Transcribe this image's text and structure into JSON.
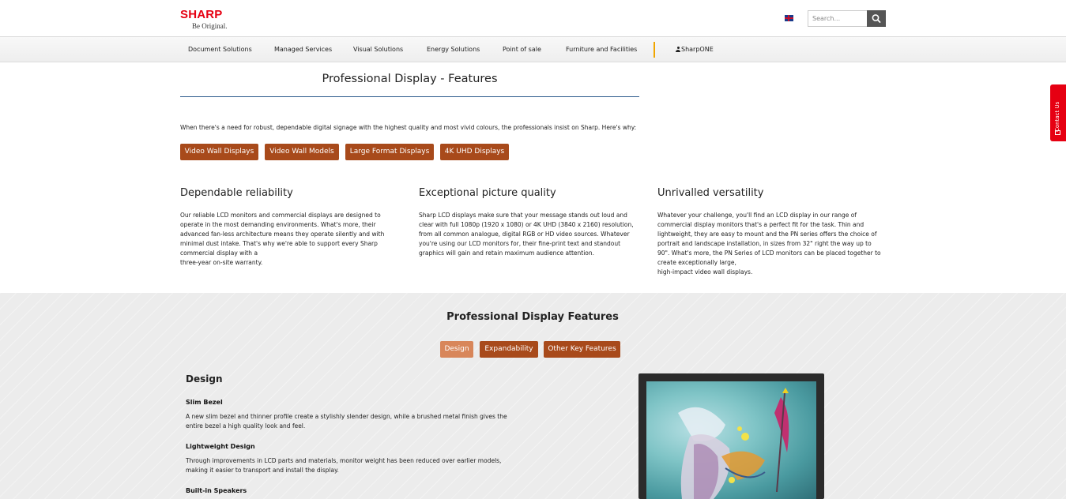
{
  "header": {
    "brand": "SHARP",
    "tagline": "Be Original.",
    "language_icon": "uk-flag-icon",
    "search": {
      "placeholder": "Search...",
      "icon": "search-icon"
    }
  },
  "nav": {
    "items": [
      {
        "label": "Document Solutions"
      },
      {
        "label": "Managed Services"
      },
      {
        "label": "Visual Solutions"
      },
      {
        "label": "Energy Solutions"
      },
      {
        "label": "Point of sale"
      },
      {
        "label": "Furniture and Facilities"
      }
    ],
    "account": {
      "label": "SharpONE",
      "icon": "user-icon"
    }
  },
  "main": {
    "title": "Professional Display - Features",
    "intro": "When there's a need for robust, dependable digital signage with the highest quality and most vivid colours, the professionals insist on Sharp. Here's why:",
    "buttons": [
      {
        "label": "Video Wall Displays"
      },
      {
        "label": "Video Wall Models"
      },
      {
        "label": "Large Format Displays"
      },
      {
        "label": "4K UHD Displays"
      }
    ],
    "columns": [
      {
        "heading": "Dependable reliability",
        "lines": [
          "Our reliable LCD monitors and commercial displays are designed to",
          "operate in the most demanding environments. What's more, their",
          "advanced fan-less architecture means they operate silently and with",
          "minimal dust intake. That's why we're able to support every Sharp",
          "commercial display with a",
          "three-year on-site warranty."
        ]
      },
      {
        "heading": "Exceptional picture quality",
        "lines": [
          "Sharp LCD displays make sure that your message stands out loud and",
          "clear with full 1080p (1920 x 1080) or 4K UHD (3840 x 2160) resolution,",
          "from all common analogue, digital RGB or HD video sources. Whatever",
          "you're using our LCD monitors for, their fine-print text and standout",
          "graphics will gain and retain maximum audience attention."
        ]
      },
      {
        "heading": "Unrivalled versatility",
        "lines": [
          "Whatever your challenge, you'll find an LCD display in our range of",
          "commercial display monitors that's a perfect fit for the task. Thin and",
          "lightweight, they are easy to mount and the PN series offers the choice of",
          "portrait and landscape installation, in sizes from 32\" right the way up to",
          "90\". What's more, the PN Series of LCD monitors can be placed together to",
          "create exceptionally large,",
          "high-impact video wall displays."
        ]
      }
    ]
  },
  "features": {
    "title": "Professional Display Features",
    "tabs": [
      {
        "label": "Design",
        "active": true
      },
      {
        "label": "Expandability",
        "active": false
      },
      {
        "label": "Other Key Features",
        "active": false
      }
    ],
    "section_heading": "Design",
    "items": [
      {
        "title": "Slim Bezel",
        "lines": [
          "A new slim bezel and thinner profile create a stylishly slender design, while a brushed metal finish gives the",
          "entire bezel a high quality look and feel."
        ]
      },
      {
        "title": "Lightweight Design",
        "lines": [
          "Through improvements in LCD parts and materials, monitor weight has been reduced over earlier models,",
          "making it easier to transport and install the display."
        ]
      },
      {
        "title": "Built-in Speakers",
        "lines": []
      }
    ],
    "image_icon": "display-monitor-image"
  },
  "contact_tab": {
    "label": "Contact Us",
    "icon": "envelope-icon"
  },
  "colors": {
    "brand_red": "#e60012",
    "button_brown": "#a84a1b",
    "tab_active": "#d8865a",
    "nav_separator": "#f0a500",
    "title_rule": "#2c5a8c"
  }
}
